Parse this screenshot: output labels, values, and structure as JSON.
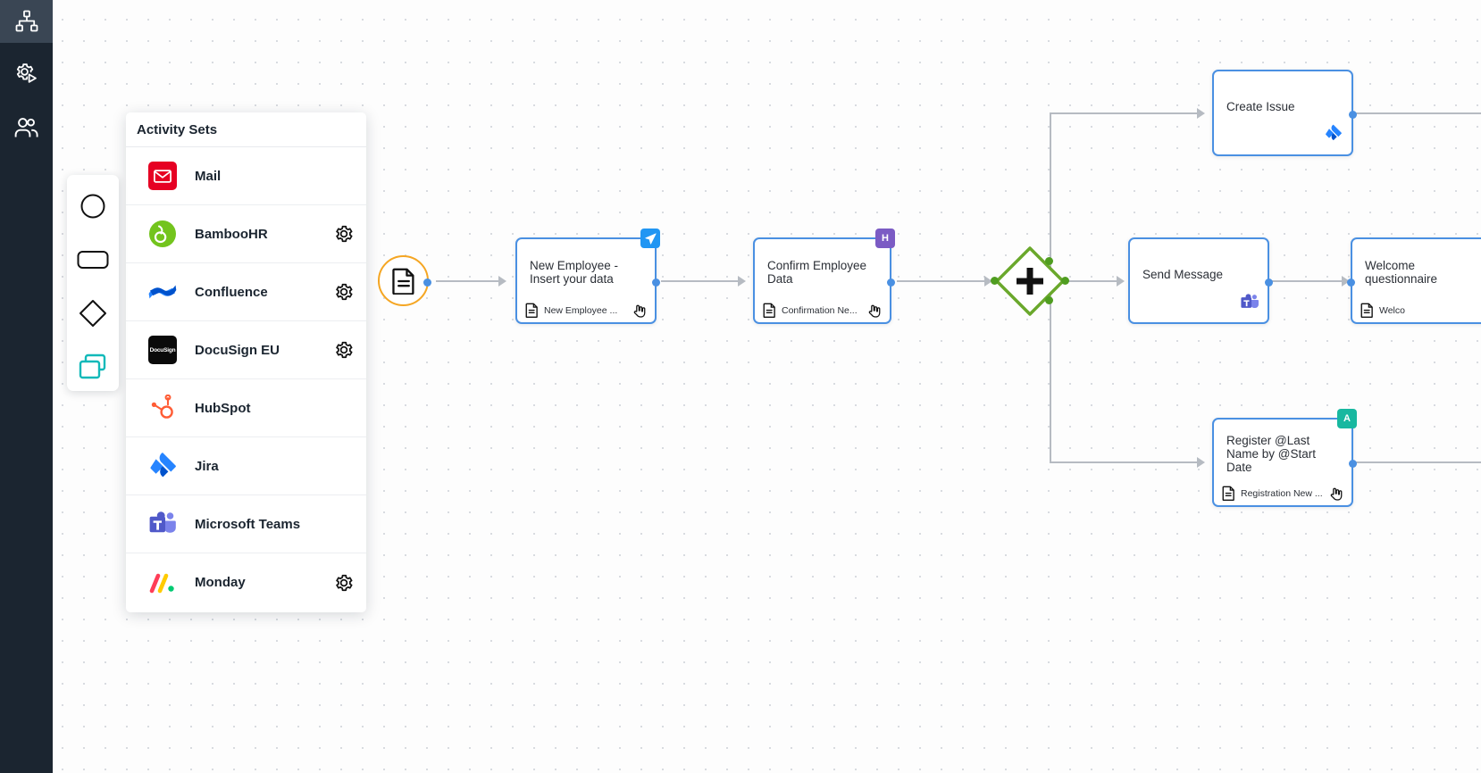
{
  "rail": {
    "items": [
      {
        "name": "org-chart",
        "icon": "org-chart-icon",
        "active": true
      },
      {
        "name": "settings-run",
        "icon": "gear-play-icon",
        "active": false
      },
      {
        "name": "users",
        "icon": "users-icon",
        "active": false
      }
    ]
  },
  "shape_palette": {
    "items": [
      {
        "name": "circle",
        "icon": "circle-shape-icon",
        "selected": false
      },
      {
        "name": "rounded-rectangle",
        "icon": "rounded-rectangle-shape-icon",
        "selected": false
      },
      {
        "name": "diamond",
        "icon": "diamond-shape-icon",
        "selected": false
      },
      {
        "name": "activity-set",
        "icon": "stacked-cards-icon",
        "selected": true
      }
    ],
    "selected_color": "#11b9b9"
  },
  "activity_panel": {
    "title": "Activity Sets",
    "items": [
      {
        "label": "Mail",
        "icon": "mail-icon",
        "gear": false
      },
      {
        "label": "BambooHR",
        "icon": "bamboohr-icon",
        "gear": true
      },
      {
        "label": "Confluence",
        "icon": "confluence-icon",
        "gear": true
      },
      {
        "label": "DocuSign EU",
        "icon": "docusign-icon",
        "gear": true
      },
      {
        "label": "HubSpot",
        "icon": "hubspot-icon",
        "gear": false
      },
      {
        "label": "Jira",
        "icon": "jira-icon",
        "gear": false
      },
      {
        "label": "Microsoft Teams",
        "icon": "microsoft-teams-icon",
        "gear": false
      },
      {
        "label": "Monday",
        "icon": "monday-icon",
        "gear": true
      }
    ]
  },
  "flow": {
    "start_event": {
      "name": "start-event",
      "icon": "document-icon",
      "color": "#f5a623"
    },
    "gateway": {
      "name": "parallel-gateway",
      "icon": "plus-icon",
      "color": "#6aa82c"
    },
    "nodes": [
      {
        "id": "new-employee",
        "title": "New Employee - Insert your data",
        "footer": "New Employee ...",
        "footer_icon": "document-icon",
        "action_icon": "hand-pointer-icon",
        "badge": {
          "glyph": "➤",
          "color": "#2196f3",
          "label": "send"
        }
      },
      {
        "id": "confirm-employee-data",
        "title": "Confirm Employee Data",
        "footer": "Confirmation Ne...",
        "footer_icon": "document-icon",
        "action_icon": "hand-pointer-icon",
        "badge": {
          "glyph": "H",
          "color": "#7b5bc4",
          "label": "H"
        }
      },
      {
        "id": "create-issue",
        "title": "Create Issue",
        "footer": "",
        "brand_icon": "jira-icon",
        "badge": null
      },
      {
        "id": "send-message",
        "title": "Send Message",
        "footer": "",
        "brand_icon": "microsoft-teams-icon",
        "badge": null
      },
      {
        "id": "welcome-questionnaire",
        "title": "Welcome questionnaire",
        "footer": "Welco",
        "footer_icon": "document-icon",
        "badge": null
      },
      {
        "id": "register-last-name",
        "title": "Register @Last Name by @Start Date",
        "footer": "Registration New ...",
        "footer_icon": "document-icon",
        "action_icon": "hand-pointer-icon",
        "badge": {
          "glyph": "A",
          "color": "#18b8a0",
          "label": "A"
        }
      }
    ]
  },
  "colors": {
    "node_border": "#4a90e2",
    "edge": "#b6bbc2",
    "rail_bg": "#1b2530",
    "rail_active": "#3a4654",
    "gateway_green": "#6aa82c",
    "start_orange": "#f5a623"
  }
}
